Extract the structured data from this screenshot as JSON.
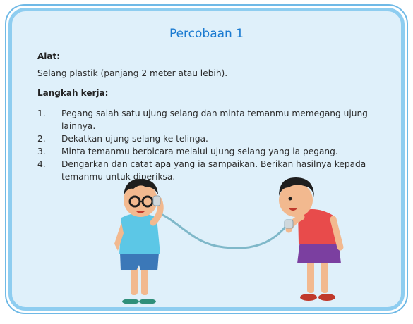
{
  "title": "Percobaan 1",
  "tools": {
    "heading": "Alat:",
    "text": "Selang plastik (panjang 2 meter atau lebih)."
  },
  "procedure": {
    "heading": "Langkah kerja:",
    "steps": [
      {
        "num": "1.",
        "text": "Pegang salah satu ujung selang dan minta temanmu memegang ujung lainnya."
      },
      {
        "num": "2.",
        "text": "Dekatkan ujung selang ke telinga."
      },
      {
        "num": "3.",
        "text": "Minta temanmu berbicara melalui ujung selang yang ia pegang."
      },
      {
        "num": "4.",
        "text": "Dengarkan dan catat apa yang ia sampaikan. Berikan hasilnya kepada temanmu untuk diperiksa."
      }
    ]
  },
  "colors": {
    "card_bg": "#dff0fa",
    "card_border": "#8ecdf0",
    "title": "#1b7bd1"
  }
}
